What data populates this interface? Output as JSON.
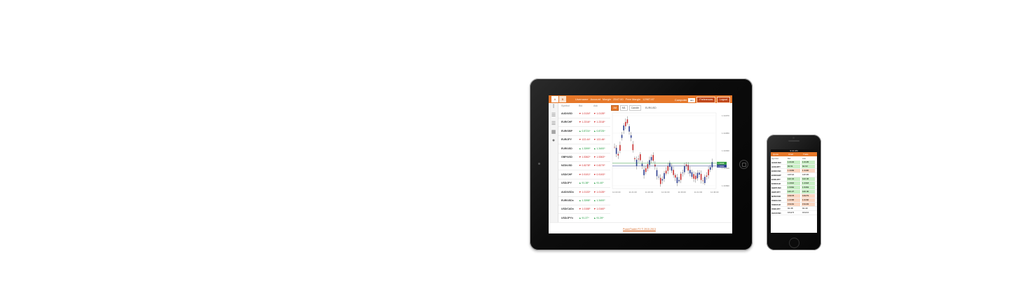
{
  "tablet": {
    "tabs": [
      "A",
      "B"
    ],
    "topbar": {
      "stats": [
        "Username",
        "Account",
        "Margin",
        "2547.00",
        "Free Margin",
        "12987.87"
      ],
      "company_label": "Computer",
      "company_value": "EN",
      "preferences": "Preferences",
      "logout": "Logout"
    },
    "quotes_header": [
      "Symbol",
      "Bid",
      "Ask"
    ],
    "quotes": [
      {
        "symbol": "AUD/USD",
        "bid": "▼ 1.0134⁵",
        "ask": "▼ 1.0135⁵",
        "dir": "dn"
      },
      {
        "symbol": "EUR/CHF",
        "bid": "▼ 1.2316⁸",
        "ask": "▼ 1.2318⁸",
        "dir": "dn"
      },
      {
        "symbol": "EUR/GBP",
        "bid": "▲ 0.8724⁴",
        "ask": "▲ 0.8725⁴",
        "dir": "up"
      },
      {
        "symbol": "EUR/JPY",
        "bid": "▼ 122.44⁶",
        "ask": "▼ 122.46⁶",
        "dir": "dn"
      },
      {
        "symbol": "EUR/USD",
        "bid": "▲ 1.3399⁸",
        "ask": "▲ 1.3400⁸",
        "dir": "up"
      },
      {
        "symbol": "GBP/USD",
        "bid": "▼ 1.5362⁸",
        "ask": "▼ 1.5363⁸",
        "dir": "dn"
      },
      {
        "symbol": "NZD/USD",
        "bid": "▼ 0.8278⁵",
        "ask": "▼ 0.8279⁵",
        "dir": "dn"
      },
      {
        "symbol": "USD/CHF",
        "bid": "▼ 0.9191⁸",
        "ask": "▼ 0.9193⁸",
        "dir": "dn"
      },
      {
        "symbol": "USD/JPY",
        "bid": "▲ 91.38⁵",
        "ask": "▲ 91.40⁵",
        "dir": "up"
      },
      {
        "symbol": "AUD/USDx",
        "bid": "▼ 1.0133⁸",
        "ask": "▼ 1.0135⁸",
        "dir": "dn"
      },
      {
        "symbol": "EUR/USDx",
        "bid": "▲ 1.3398⁸",
        "ask": "▲ 1.3400⁸",
        "dir": "up"
      },
      {
        "symbol": "USD/CADx",
        "bid": "▼ 1.0158⁵",
        "ask": "▼ 1.0160⁵",
        "dir": "dn"
      },
      {
        "symbol": "USD/JPYx",
        "bid": "▲ 91.37⁸",
        "ask": "▲ 91.39⁸",
        "dir": "up"
      }
    ],
    "chart_toolbar": {
      "timeframe": "1M",
      "interval": "M1",
      "mode": "Candle",
      "pair": "EUR/USD"
    },
    "chart_data": {
      "type": "line",
      "title": "",
      "xlabel": "",
      "ylabel": "",
      "x": [
        "11:16:00",
        "11:21:00",
        "11:26:00",
        "11:31:00",
        "11:36:00",
        "11:41:00",
        "11:46:00"
      ],
      "y_ticks": [
        "1.34070",
        "1.34050",
        "1.34030",
        "1.34010",
        "1.33990"
      ],
      "series": [
        {
          "values": [
            1.3403,
            1.3402,
            1.3405,
            1.3406,
            1.3404,
            1.3401,
            1.3402,
            1.34,
            1.3401,
            1.3402,
            1.34,
            1.3399,
            1.34,
            1.3401,
            1.34,
            1.3399,
            1.34,
            1.3401,
            1.34,
            1.33995,
            1.34,
            1.3399,
            1.34,
            1.3401
          ]
        }
      ],
      "price_tags": [
        {
          "label": "1.33998",
          "color": "#2e9a3a"
        },
        {
          "label": "1.33990",
          "color": "#2b3d8f"
        }
      ]
    },
    "footer": "PowerTrader FX © 2010-2013"
  },
  "phone": {
    "status": "9:41 AM",
    "tabs": [
      "Quote",
      "Chart",
      "Trade"
    ],
    "header": [
      "Symbol",
      "Bid",
      "Ask"
    ],
    "rows": [
      {
        "symbol": "AUD/USD",
        "bid": "1.0134",
        "ask": "1.0135",
        "color": "#c9efc5"
      },
      {
        "symbol": "AUD/JPY",
        "bid": "92.61",
        "ask": "92.63",
        "color": "#c9efc5"
      },
      {
        "symbol": "EUR/USD",
        "bid": "1.3399",
        "ask": "1.3400",
        "color": "#fbd7c2"
      },
      {
        "symbol": "EUR/GBP",
        "bid": "0.8724",
        "ask": "0.8725",
        "color": "#ffffff"
      },
      {
        "symbol": "EUR/JPY",
        "bid": "122.44",
        "ask": "122.46",
        "color": "#c9efc5"
      },
      {
        "symbol": "EUR/CHF",
        "bid": "1.2316",
        "ask": "1.2318",
        "color": "#c9efc5"
      },
      {
        "symbol": "GBP/USD",
        "bid": "1.5362",
        "ask": "1.5363",
        "color": "#c9efc5"
      },
      {
        "symbol": "GBP/JPY",
        "bid": "140.27",
        "ask": "140.30",
        "color": "#c9efc5"
      },
      {
        "symbol": "NZD/USD",
        "bid": "0.8278",
        "ask": "0.8279",
        "color": "#fbd7c2"
      },
      {
        "symbol": "USD/CAD",
        "bid": "1.0158",
        "ask": "1.0160",
        "color": "#fbd7c2"
      },
      {
        "symbol": "USD/CHF",
        "bid": "0.9191",
        "ask": "0.9193",
        "color": "#fbd7c2"
      },
      {
        "symbol": "USD/JPY",
        "bid": "91.38",
        "ask": "91.40",
        "color": "#ffffff"
      },
      {
        "symbol": "XAU/USD",
        "bid": "1612.5",
        "ask": "1613.0",
        "color": "#ffffff"
      }
    ]
  }
}
